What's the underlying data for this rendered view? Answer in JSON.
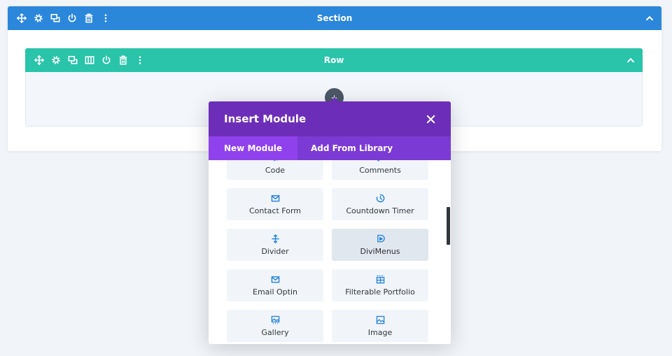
{
  "colors": {
    "section_bar": "#2b87da",
    "row_bar": "#29c4a9",
    "modal_header": "#6c2eb9",
    "modal_tabs": "#7b3ad3",
    "module_icon": "#2b87da"
  },
  "section": {
    "title": "Section",
    "icons": [
      "move-icon",
      "gear-icon",
      "duplicate-icon",
      "power-icon",
      "trash-icon",
      "more-icon"
    ]
  },
  "row": {
    "title": "Row",
    "icons": [
      "move-icon",
      "gear-icon",
      "duplicate-icon",
      "columns-icon",
      "power-icon",
      "trash-icon",
      "more-icon"
    ]
  },
  "modal": {
    "title": "Insert Module",
    "tabs": [
      {
        "label": "New Module",
        "active": true
      },
      {
        "label": "Add From Library",
        "active": false
      }
    ],
    "modules": [
      {
        "label": "Code",
        "icon": "code-icon"
      },
      {
        "label": "Comments",
        "icon": "comments-icon"
      },
      {
        "label": "Contact Form",
        "icon": "envelope-icon"
      },
      {
        "label": "Countdown Timer",
        "icon": "timer-icon"
      },
      {
        "label": "Divider",
        "icon": "divider-icon"
      },
      {
        "label": "DiviMenus",
        "icon": "divimenus-icon",
        "hovered": true
      },
      {
        "label": "Email Optin",
        "icon": "envelope-icon"
      },
      {
        "label": "Filterable Portfolio",
        "icon": "portfolio-grid-icon"
      },
      {
        "label": "Gallery",
        "icon": "gallery-icon"
      },
      {
        "label": "Image",
        "icon": "image-icon"
      }
    ]
  }
}
